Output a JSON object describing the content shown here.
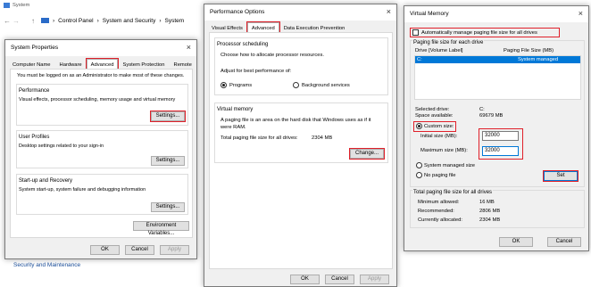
{
  "bg_window": {
    "title": "System",
    "breadcrumb": [
      "Control Panel",
      "System and Security",
      "System"
    ],
    "footer_link": "Security and Maintenance"
  },
  "system_properties": {
    "title": "System Properties",
    "tabs": [
      "Computer Name",
      "Hardware",
      "Advanced",
      "System Protection",
      "Remote"
    ],
    "admin_note": "You must be logged on as an Administrator to make most of these changes.",
    "performance": {
      "title": "Performance",
      "desc": "Visual effects, processor scheduling, memory usage and virtual memory",
      "button": "Settings..."
    },
    "user_profiles": {
      "title": "User Profiles",
      "desc": "Desktop settings related to your sign-in",
      "button": "Settings..."
    },
    "startup": {
      "title": "Start-up and Recovery",
      "desc": "System start-up, system failure and debugging information",
      "button": "Settings..."
    },
    "env_button": "Environment Variables...",
    "ok": "OK",
    "cancel": "Cancel",
    "apply": "Apply"
  },
  "performance_options": {
    "title": "Performance Options",
    "tabs": [
      "Visual Effects",
      "Advanced",
      "Data Execution Prevention"
    ],
    "proc": {
      "title": "Processor scheduling",
      "desc": "Choose how to allocate processor resources.",
      "adjust": "Adjust for best performance of:",
      "programs": "Programs",
      "background": "Background services"
    },
    "vm": {
      "title": "Virtual memory",
      "desc": "A paging file is an area on the hard disk that Windows uses as if it were RAM.",
      "total_label": "Total paging file size for all drives:",
      "total_value": "2304 MB",
      "change": "Change..."
    },
    "ok": "OK",
    "cancel": "Cancel",
    "apply": "Apply"
  },
  "virtual_memory": {
    "title": "Virtual Memory",
    "auto_manage": "Automatically manage paging file size for all drives",
    "section_title": "Paging file size for each drive",
    "col_drive": "Drive  [Volume Label]",
    "col_size": "Paging File Size (MB)",
    "row_drive": "C:",
    "row_size": "System managed",
    "selected_drive_label": "Selected drive:",
    "selected_drive_value": "C:",
    "space_label": "Space available:",
    "space_value": "69679 MB",
    "custom_size": "Custom size:",
    "initial_label": "Initial size (MB):",
    "initial_value": "32000",
    "max_label": "Maximum size (MB):",
    "max_value": "32000",
    "system_managed": "System managed size",
    "no_paging": "No paging file",
    "set": "Set",
    "totals_title": "Total paging file size for all drives",
    "min_label": "Minimum allowed:",
    "min_value": "16 MB",
    "rec_label": "Recommended:",
    "rec_value": "2806 MB",
    "cur_label": "Currently allocated:",
    "cur_value": "2304 MB",
    "ok": "OK",
    "cancel": "Cancel"
  }
}
